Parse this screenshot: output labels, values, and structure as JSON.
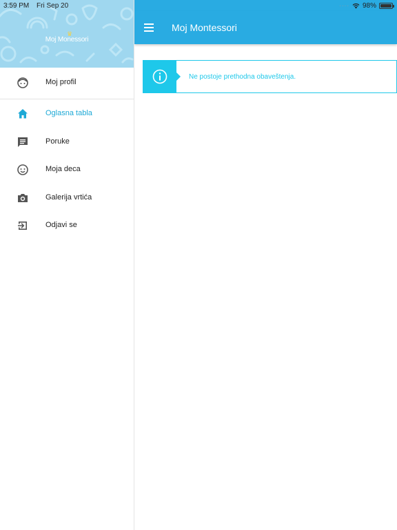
{
  "status_bar": {
    "time": "3:59 PM",
    "date": "Fri Sep 20",
    "battery": "98%",
    "battery_level": 0.98
  },
  "drawer": {
    "logo_text_1": "Moj Mon",
    "logo_text_2": "essori",
    "items": [
      {
        "label": "Moj profil",
        "icon": "face-icon"
      },
      {
        "label": "Oglasna tabla",
        "icon": "home-icon",
        "active": true
      },
      {
        "label": "Poruke",
        "icon": "message-icon"
      },
      {
        "label": "Moja deca",
        "icon": "child-face-icon"
      },
      {
        "label": "Galerija vrtića",
        "icon": "camera-icon"
      },
      {
        "label": "Odjavi se",
        "icon": "logout-icon"
      }
    ]
  },
  "appbar": {
    "title": "Moj Montessori"
  },
  "notice": {
    "text": "Ne postoje prethodna obaveštenja."
  },
  "colors": {
    "primary": "#29abe2",
    "accent": "#1ec8ea",
    "header_bg": "#9fd7ef"
  }
}
